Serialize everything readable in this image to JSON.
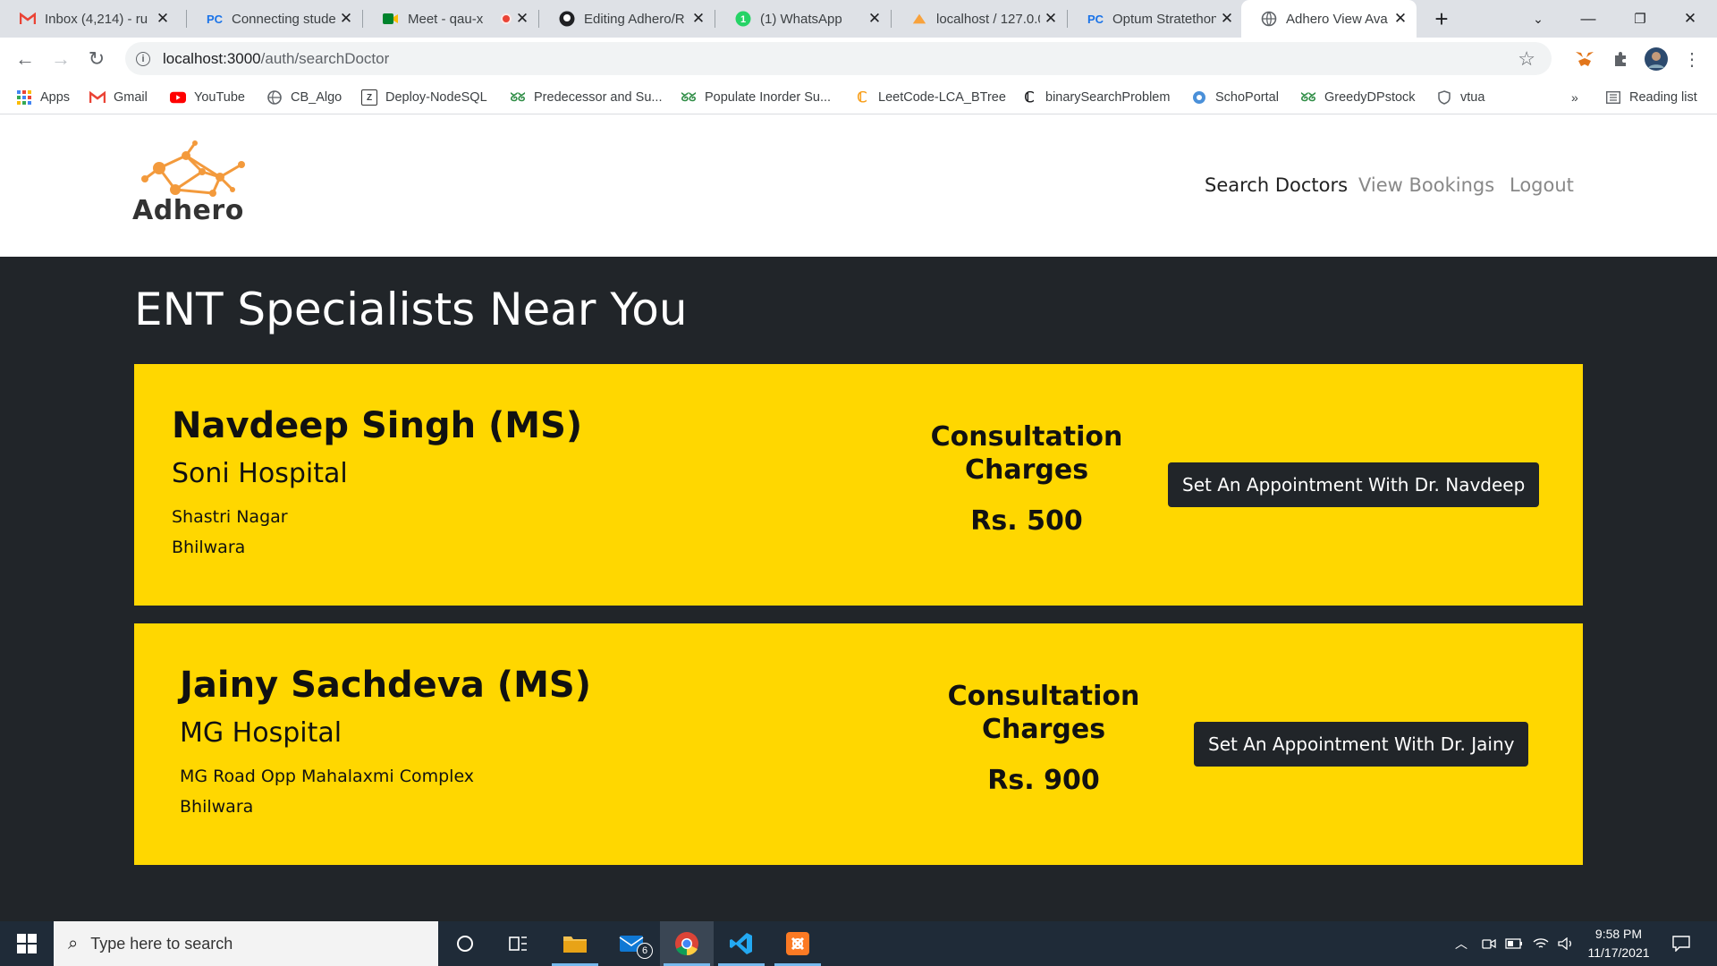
{
  "browser": {
    "tabs": [
      {
        "title": "Inbox (4,214) - ru",
        "icon": "gmail-icon"
      },
      {
        "title": "Connecting stude",
        "icon": "pc-icon"
      },
      {
        "title": "Meet - qau-x",
        "icon": "meet-icon"
      },
      {
        "title": "Editing Adhero/R",
        "icon": "github-icon"
      },
      {
        "title": "(1) WhatsApp",
        "icon": "whatsapp-icon"
      },
      {
        "title": "localhost / 127.0.0",
        "icon": "phpmyadmin-icon"
      },
      {
        "title": "Optum Stratethon",
        "icon": "pc-icon"
      },
      {
        "title": "Adhero View Ava",
        "icon": "globe-icon"
      }
    ],
    "url": {
      "host": "localhost:3000",
      "path": "/auth/searchDoctor"
    },
    "bookmarks": [
      {
        "label": "Apps"
      },
      {
        "label": "Gmail"
      },
      {
        "label": "YouTube"
      },
      {
        "label": "CB_Algo"
      },
      {
        "label": "Deploy-NodeSQL"
      },
      {
        "label": "Predecessor and Su..."
      },
      {
        "label": "Populate Inorder Su..."
      },
      {
        "label": "LeetCode-LCA_BTree"
      },
      {
        "label": "binarySearchProblem"
      },
      {
        "label": "SchoPortal"
      },
      {
        "label": "GreedyDPstock"
      },
      {
        "label": "vtua"
      }
    ],
    "bookmarks_overflow": "»",
    "reading_list": "Reading list"
  },
  "site": {
    "brand": "Adhero",
    "nav": [
      {
        "label": "Search Doctors",
        "active": true
      },
      {
        "label": "View Bookings",
        "active": false
      },
      {
        "label": "Logout",
        "active": false
      }
    ]
  },
  "page": {
    "title": "ENT Specialists Near You",
    "doctors": [
      {
        "name": "Navdeep Singh (MS)",
        "hospital": "Soni Hospital",
        "address_line1": "Shastri Nagar",
        "address_line2": "Bhilwara",
        "charges_label": "Consultation Charges",
        "charges": "Rs. 500",
        "button": "Set An Appointment With Dr. Navdeep"
      },
      {
        "name": "Jainy Sachdeva (MS)",
        "hospital": "MG Hospital",
        "address_line1": "MG Road Opp Mahalaxmi Complex",
        "address_line2": "Bhilwara",
        "charges_label": "Consultation Charges",
        "charges": "Rs. 900",
        "button": "Set An Appointment With Dr. Jainy"
      }
    ]
  },
  "taskbar": {
    "search_placeholder": "Type here to search",
    "mail_badge": "6",
    "time": "9:58 PM",
    "date": "11/17/2021"
  },
  "colors": {
    "card": "#ffd700",
    "dark": "#212529",
    "logo_orange": "#f39a3c"
  }
}
